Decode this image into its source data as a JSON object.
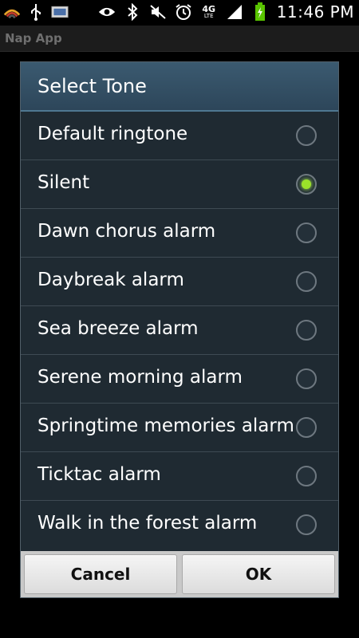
{
  "status_bar": {
    "time": "11:46 PM",
    "network": "4G",
    "network_sub": "LTE",
    "icons": [
      "wifi-signal-icon",
      "usb-icon",
      "image-icon",
      "eye-icon",
      "bluetooth-icon",
      "mute-icon",
      "alarm-icon",
      "network-4g-lte-icon",
      "signal-strength-icon",
      "battery-charging-icon"
    ],
    "battery_color": "#59c400"
  },
  "app": {
    "title": "Nap App"
  },
  "dialog": {
    "title": "Select Tone",
    "items": [
      {
        "label": "Default ringtone",
        "checked": false
      },
      {
        "label": "Silent",
        "checked": true
      },
      {
        "label": "Dawn chorus alarm",
        "checked": false
      },
      {
        "label": "Daybreak alarm",
        "checked": false
      },
      {
        "label": "Sea breeze alarm",
        "checked": false
      },
      {
        "label": "Serene morning alarm",
        "checked": false
      },
      {
        "label": "Springtime memories alarm",
        "checked": false
      },
      {
        "label": "Ticktac alarm",
        "checked": false
      },
      {
        "label": "Walk in the forest alarm",
        "checked": false
      }
    ],
    "buttons": {
      "cancel": "Cancel",
      "ok": "OK"
    },
    "accent_color": "#9be12a"
  }
}
